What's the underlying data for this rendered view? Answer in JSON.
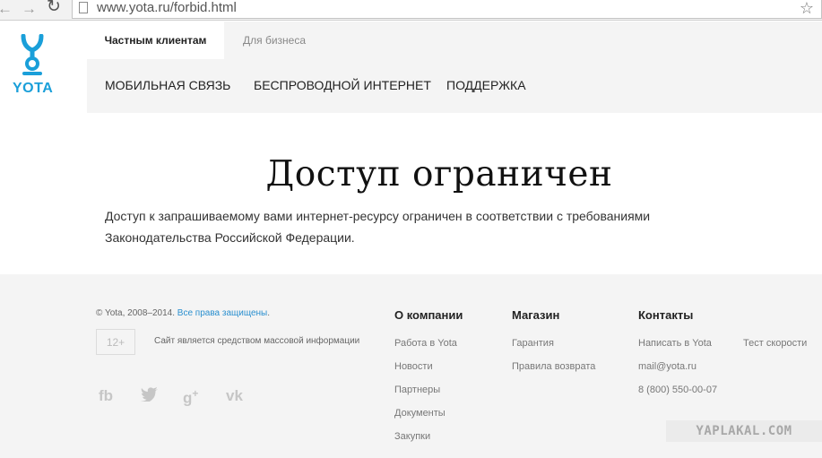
{
  "browser": {
    "url": "www.yota.ru/forbid.html",
    "back_icon": "back-arrow-icon",
    "forward_icon": "forward-arrow-icon",
    "reload_icon": "reload-icon",
    "star_icon": "star-icon"
  },
  "logo": {
    "text": "YOTA",
    "color": "#1a9fd9"
  },
  "header": {
    "tabs": [
      {
        "label": "Частным клиентам",
        "active": true
      },
      {
        "label": "Для бизнеса",
        "active": false
      }
    ],
    "main_nav": [
      "МОБИЛЬНАЯ СВЯЗЬ",
      "БЕСПРОВОДНОЙ ИНТЕРНЕТ",
      "ПОДДЕРЖКА"
    ]
  },
  "content": {
    "title": "Доступ ограничен",
    "line1": "Доступ к запрашиваемому вами интернет-ресурсу ограничен в соответствии с требованиями",
    "line2": "Законодательства Российской Федерации."
  },
  "footer": {
    "copyright": "© Yota, 2008–2014.",
    "rights_link": "Все права защищены",
    "rights_suffix": ".",
    "age_rating": "12+",
    "media_note": "Сайт является средством массовой информации",
    "social_icons": [
      "fb-icon",
      "twitter-icon",
      "google-plus-icon",
      "vk-icon"
    ],
    "columns": [
      {
        "title": "О компании",
        "links": [
          "Работа в Yota",
          "Новости",
          "Партнеры",
          "Документы",
          "Закупки"
        ]
      },
      {
        "title": "Магазин",
        "links": [
          "Гарантия",
          "Правила возврата"
        ]
      },
      {
        "title": "Контакты",
        "links": [
          "Написать в Yota",
          "mail@yota.ru",
          "8 (800) 550-00-07"
        ],
        "extra_link": "Тест скорости"
      }
    ]
  },
  "watermark": "YAPLAKAL.COM"
}
